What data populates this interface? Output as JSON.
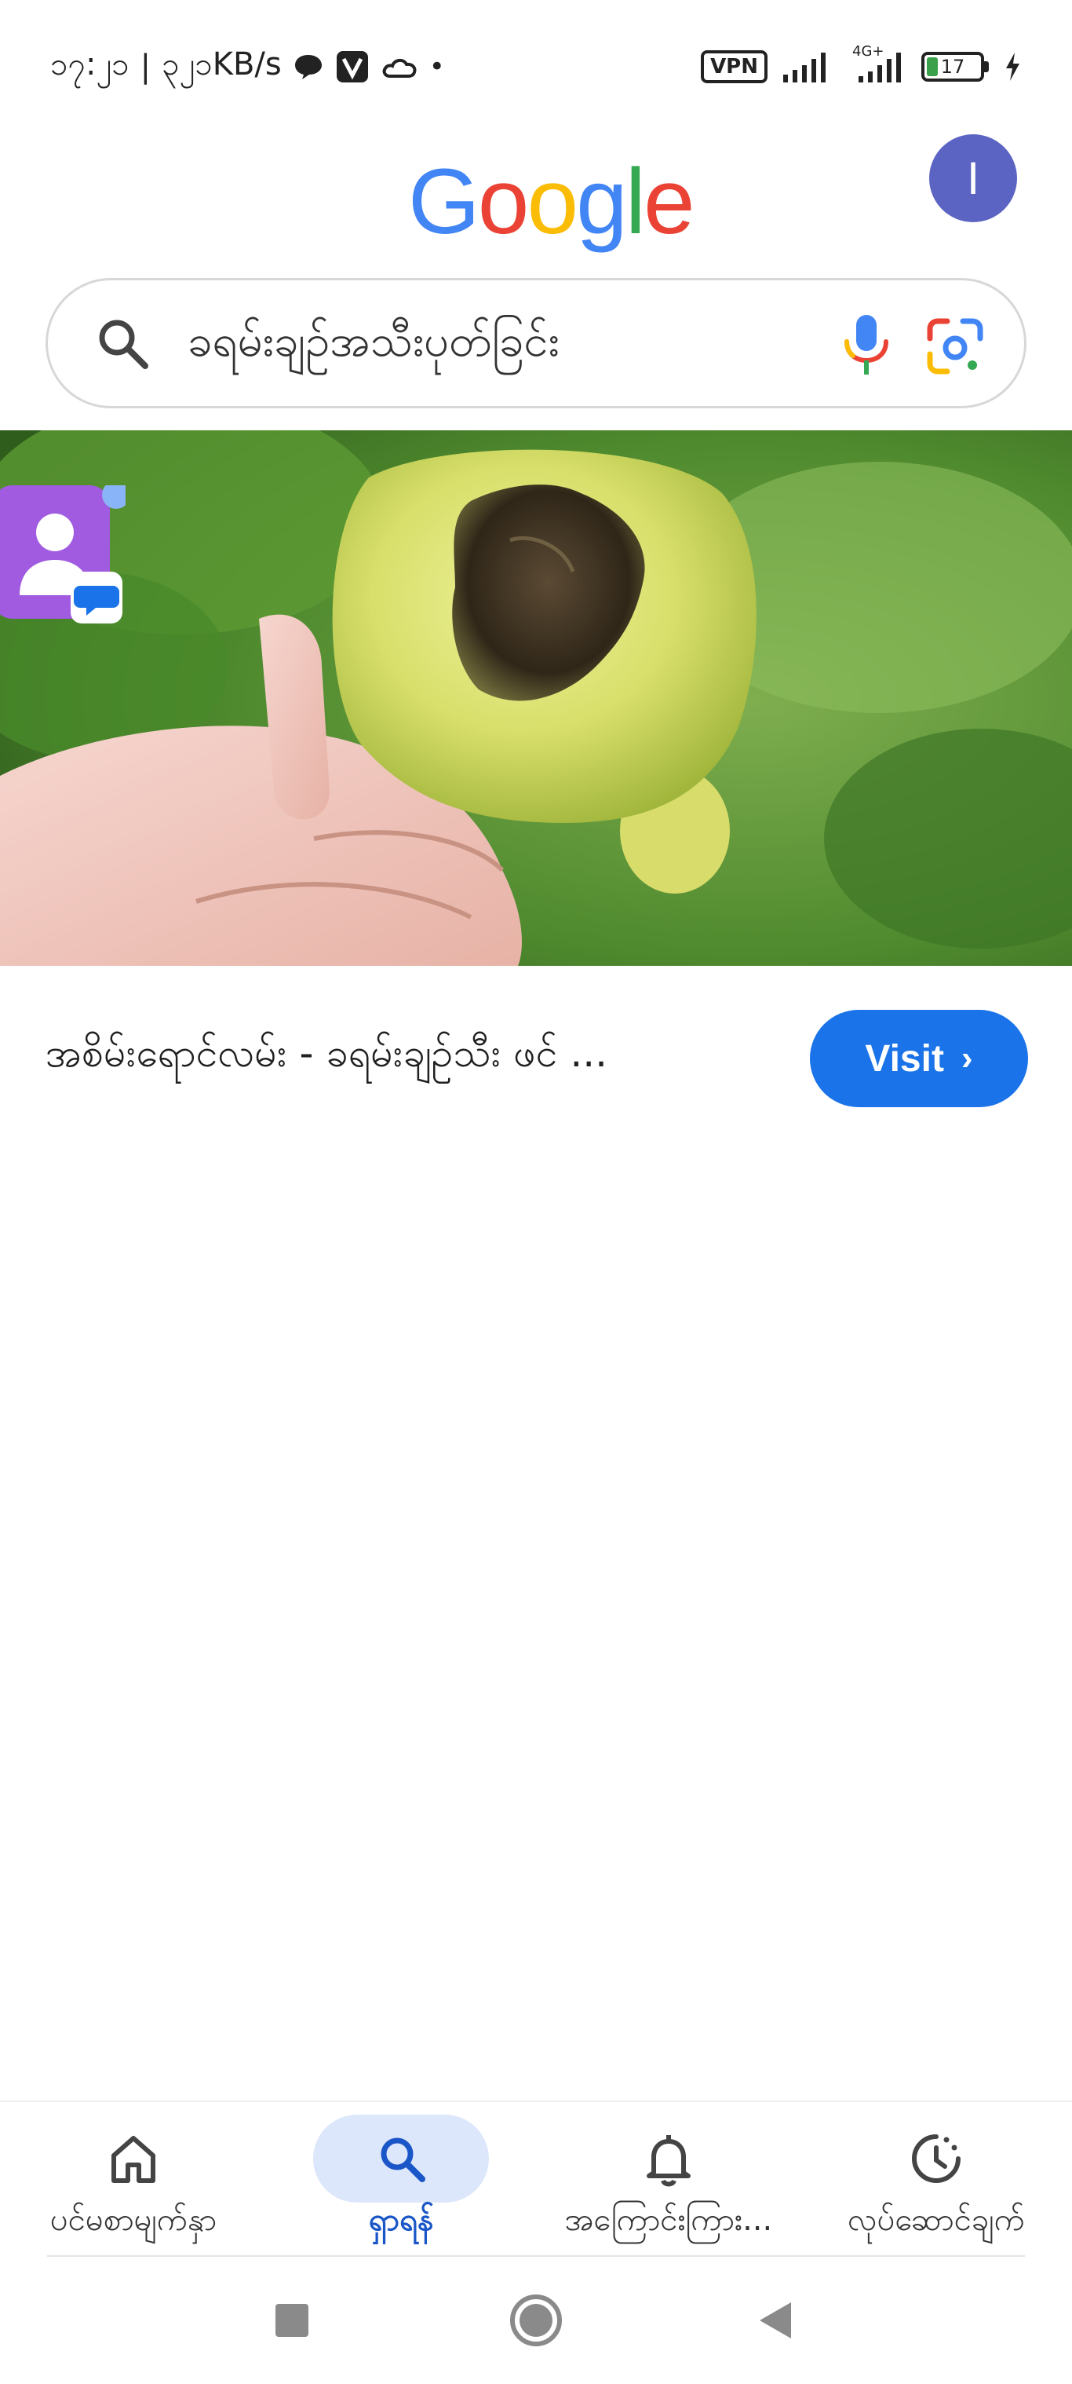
{
  "status_bar": {
    "time": "၁၇:၂၁",
    "speed": "၃၂၁KB/s",
    "vpn": "VPN",
    "network": "4G+",
    "battery": "17"
  },
  "header": {
    "logo_letters": [
      "G",
      "o",
      "o",
      "g",
      "l",
      "e"
    ],
    "avatar_initial": "I"
  },
  "search": {
    "query": "ခရမ်းချဉ်အသီးပုတ်ခြင်း"
  },
  "result": {
    "title": "အစိမ်းရောင်လမ်း - ခရမ်းချဉ်သီး ဖင် ...",
    "visit_label": "Visit",
    "visit_icon": "chevron-right-icon"
  },
  "bottom_nav": {
    "items": [
      {
        "label": "ပင်မစာမျက်နှာ",
        "icon": "home-icon"
      },
      {
        "label": "ရှာရန်",
        "icon": "search-icon",
        "active": true
      },
      {
        "label": "အကြောင်းကြား...",
        "icon": "bell-icon"
      },
      {
        "label": "လုပ်ဆောင်ချက်",
        "icon": "activity-icon"
      }
    ]
  },
  "colors": {
    "accent": "#1a73e8",
    "active_nav": "#dde7fb",
    "avatar": "#5b64c2"
  }
}
